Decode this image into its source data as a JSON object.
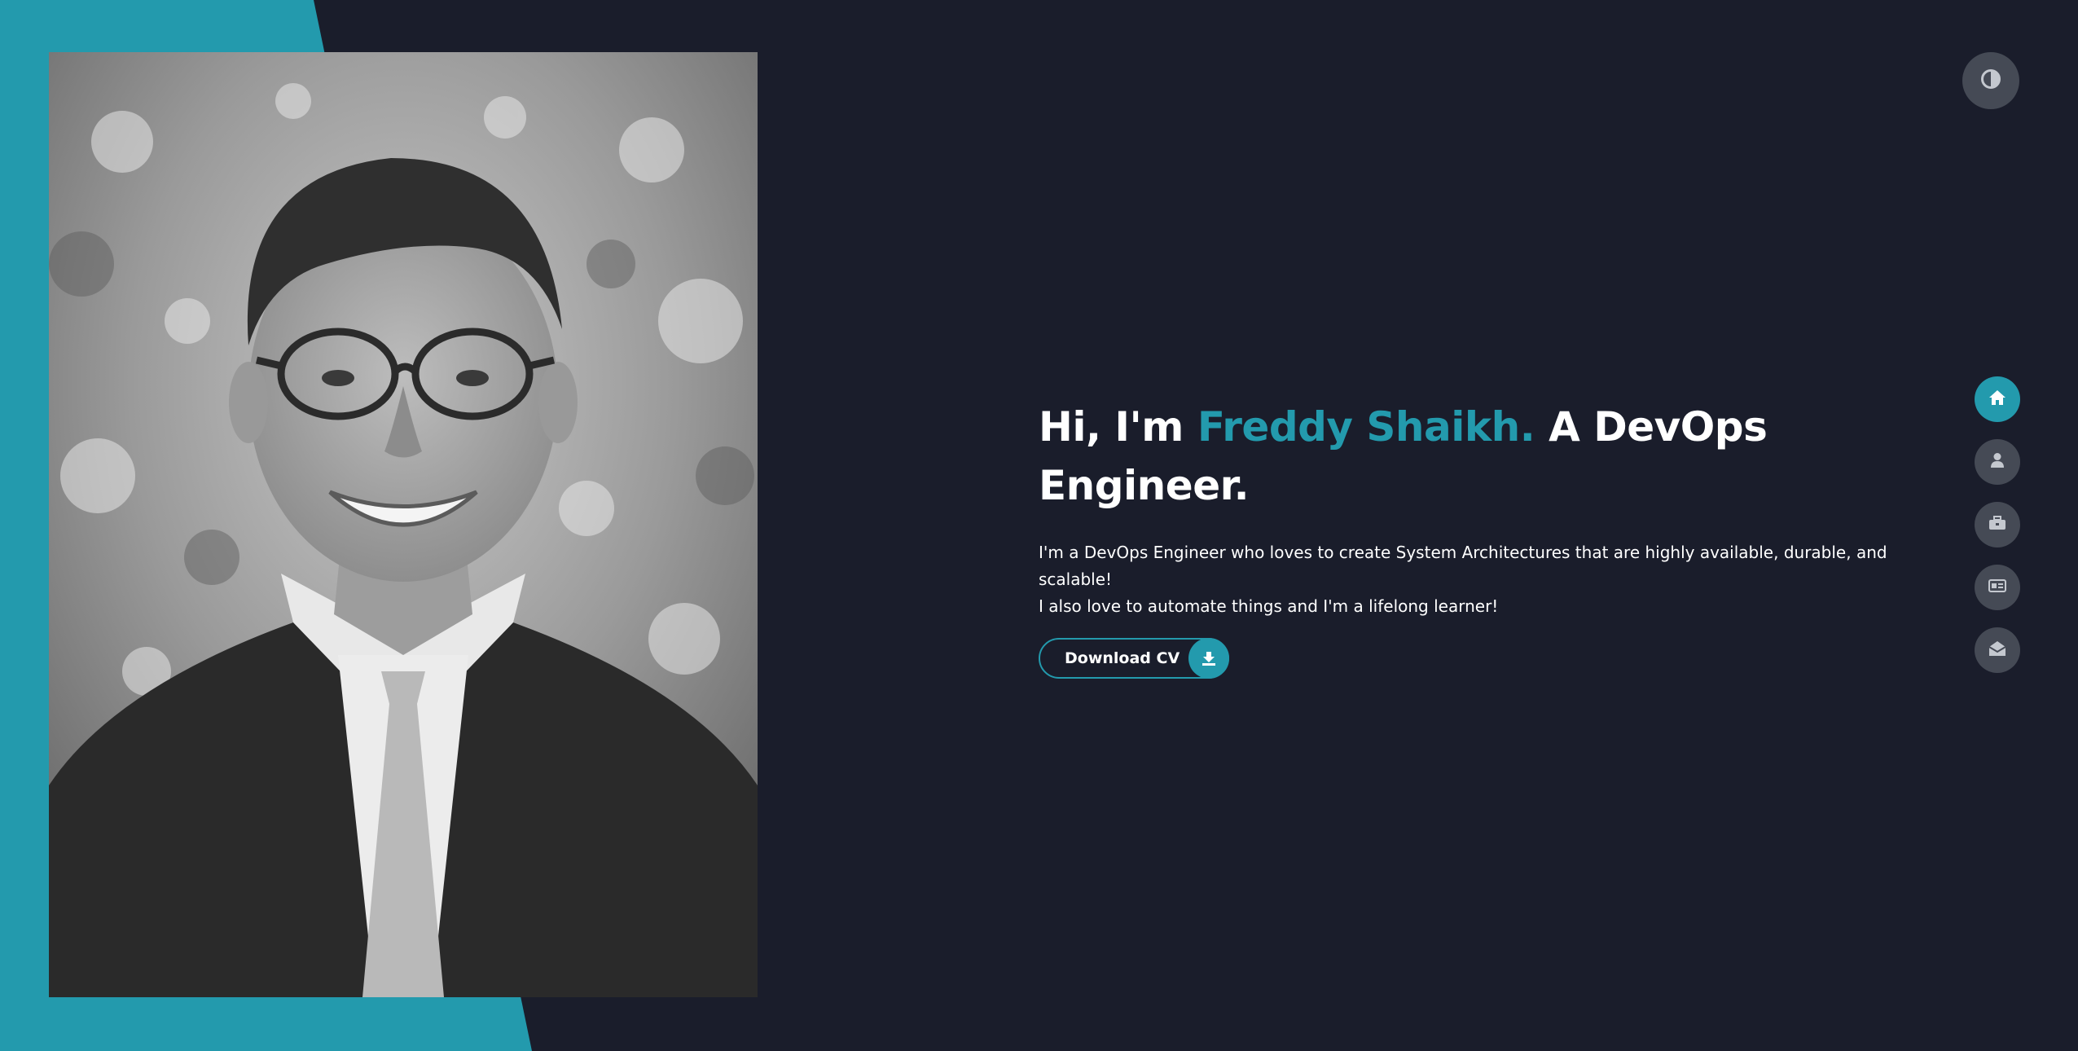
{
  "hero": {
    "greeting": "Hi, I'm ",
    "name": "Freddy Shaikh.",
    "role_line1": " A DevOps",
    "role_line2": "Engineer.",
    "bio_line1": "I'm a DevOps Engineer who loves to create System Architectures that are highly available, durable, and scalable!",
    "bio_line2": "I also love to automate things and I'm a lifelong learner!",
    "cv_button_label": "Download CV"
  },
  "colors": {
    "accent": "#239aad",
    "background": "#1a1d2b",
    "button_grey": "#454a55",
    "text": "#ffffff"
  },
  "theme_toggle": {
    "icon": "contrast-icon"
  },
  "nav": {
    "items": [
      {
        "icon": "home-icon",
        "active": true
      },
      {
        "icon": "user-icon",
        "active": false
      },
      {
        "icon": "briefcase-icon",
        "active": false
      },
      {
        "icon": "id-card-icon",
        "active": false
      },
      {
        "icon": "envelope-open-icon",
        "active": false
      }
    ]
  },
  "portrait": {
    "icon": "profile-photo"
  }
}
